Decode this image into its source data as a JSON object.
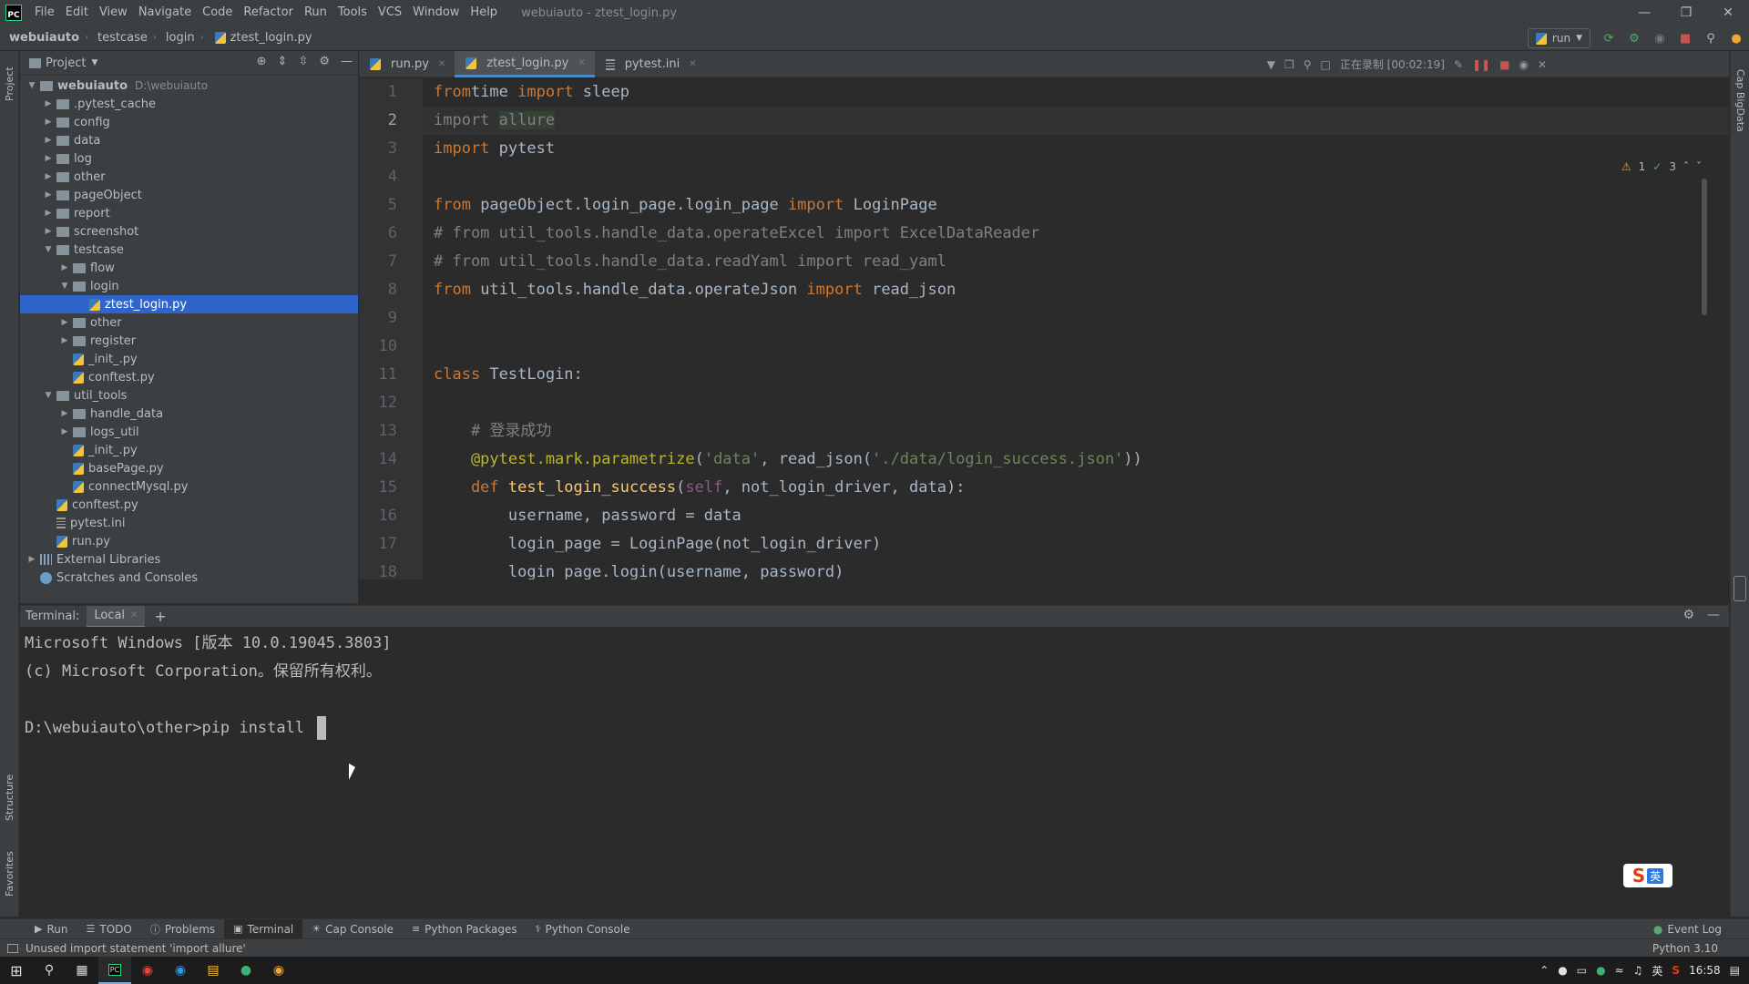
{
  "menubar": {
    "logo": "PC",
    "items": [
      "File",
      "Edit",
      "View",
      "Navigate",
      "Code",
      "Refactor",
      "Run",
      "Tools",
      "VCS",
      "Window",
      "Help"
    ],
    "title": "webuiauto - ztest_login.py"
  },
  "breadcrumb": [
    "webuiauto",
    "testcase",
    "login",
    "ztest_login.py"
  ],
  "run_config": {
    "label": "run"
  },
  "project_panel": {
    "title": "Project",
    "tree": [
      {
        "label": "webuiauto",
        "extra": "D:\\webuiauto",
        "depth": 0,
        "type": "folder",
        "open": true,
        "bold": true
      },
      {
        "label": ".pytest_cache",
        "depth": 1,
        "type": "folder",
        "open": false
      },
      {
        "label": "config",
        "depth": 1,
        "type": "folder",
        "open": false
      },
      {
        "label": "data",
        "depth": 1,
        "type": "folder",
        "open": false
      },
      {
        "label": "log",
        "depth": 1,
        "type": "folder",
        "open": false
      },
      {
        "label": "other",
        "depth": 1,
        "type": "folder",
        "open": false
      },
      {
        "label": "pageObject",
        "depth": 1,
        "type": "folder",
        "open": false
      },
      {
        "label": "report",
        "depth": 1,
        "type": "folder",
        "open": false
      },
      {
        "label": "screenshot",
        "depth": 1,
        "type": "folder",
        "open": false
      },
      {
        "label": "testcase",
        "depth": 1,
        "type": "folder",
        "open": true
      },
      {
        "label": "flow",
        "depth": 2,
        "type": "folder",
        "open": false
      },
      {
        "label": "login",
        "depth": 2,
        "type": "folder",
        "open": true
      },
      {
        "label": "ztest_login.py",
        "depth": 3,
        "type": "py",
        "selected": true
      },
      {
        "label": "other",
        "depth": 2,
        "type": "folder",
        "open": false
      },
      {
        "label": "register",
        "depth": 2,
        "type": "folder",
        "open": false
      },
      {
        "label": "_init_.py",
        "depth": 2,
        "type": "py"
      },
      {
        "label": "conftest.py",
        "depth": 2,
        "type": "py"
      },
      {
        "label": "util_tools",
        "depth": 1,
        "type": "folder",
        "open": true
      },
      {
        "label": "handle_data",
        "depth": 2,
        "type": "folder",
        "open": false
      },
      {
        "label": "logs_util",
        "depth": 2,
        "type": "folder",
        "open": false
      },
      {
        "label": "_init_.py",
        "depth": 2,
        "type": "py"
      },
      {
        "label": "basePage.py",
        "depth": 2,
        "type": "py"
      },
      {
        "label": "connectMysql.py",
        "depth": 2,
        "type": "py"
      },
      {
        "label": "conftest.py",
        "depth": 1,
        "type": "py"
      },
      {
        "label": "pytest.ini",
        "depth": 1,
        "type": "ini"
      },
      {
        "label": "run.py",
        "depth": 1,
        "type": "py"
      },
      {
        "label": "External Libraries",
        "depth": 0,
        "type": "lib",
        "open": false
      },
      {
        "label": "Scratches and Consoles",
        "depth": 0,
        "type": "scratch"
      }
    ]
  },
  "editor": {
    "tabs": [
      {
        "label": "run.py",
        "active": false
      },
      {
        "label": "ztest_login.py",
        "active": true
      },
      {
        "label": "pytest.ini",
        "active": false
      }
    ],
    "recording": "正在录制 [00:02:19]",
    "warnings": "1",
    "checks": "3",
    "current_line": 2,
    "lines": [
      [
        [
          "kw",
          "from"
        ],
        [
          "",
          "time "
        ],
        [
          "kw",
          "import"
        ],
        [
          "",
          " sleep"
        ]
      ],
      [
        [
          "unused",
          "import "
        ],
        [
          "unusedmod",
          "allure"
        ]
      ],
      [
        [
          "kw",
          "import"
        ],
        [
          "",
          " pytest"
        ]
      ],
      [],
      [
        [
          "kw",
          "from"
        ],
        [
          "",
          " pageObject.login_page.login_page "
        ],
        [
          "kw",
          "import"
        ],
        [
          "",
          " LoginPage"
        ]
      ],
      [
        [
          "cm",
          "# from util_tools.handle_data.operateExcel import ExcelDataReader"
        ]
      ],
      [
        [
          "cm",
          "# from util_tools.handle_data.readYaml import read_yaml"
        ]
      ],
      [
        [
          "kw",
          "from"
        ],
        [
          "",
          " util_tools.handle_data.operateJson "
        ],
        [
          "kw",
          "import"
        ],
        [
          "",
          " read_json"
        ]
      ],
      [],
      [],
      [
        [
          "kw",
          "class"
        ],
        [
          "",
          " TestLogin:"
        ]
      ],
      [],
      [
        [
          "cm",
          "    # 登录成功"
        ]
      ],
      [
        [
          "deco",
          "    @pytest.mark.parametrize"
        ],
        [
          "",
          "("
        ],
        [
          "str",
          "'data'"
        ],
        [
          "",
          ", read_json("
        ],
        [
          "str",
          "'./data/login_success.json'"
        ],
        [
          "",
          "))"
        ]
      ],
      [
        [
          "kw",
          "    def "
        ],
        [
          "fn",
          "test_login_success"
        ],
        [
          "",
          "("
        ],
        [
          "slf",
          "self"
        ],
        [
          "",
          ", not_login_driver, data):"
        ]
      ],
      [
        [
          "",
          "        username, password = data"
        ]
      ],
      [
        [
          "",
          "        login_page = LoginPage(not_login_driver)"
        ]
      ],
      [
        [
          "",
          "        login_page.login(username, password)"
        ]
      ]
    ]
  },
  "terminal": {
    "label": "Terminal:",
    "tab": "Local",
    "lines": [
      "Microsoft Windows [版本 10.0.19045.3803]",
      "(c) Microsoft Corporation。保留所有权利。",
      "",
      "D:\\webuiauto\\other>pip install "
    ]
  },
  "toolwindows": [
    {
      "label": "Run",
      "icon": "play-icon"
    },
    {
      "label": "TODO",
      "icon": "list-icon"
    },
    {
      "label": "Problems",
      "icon": "info-icon"
    },
    {
      "label": "Terminal",
      "icon": "terminal-icon",
      "active": true
    },
    {
      "label": "Cap Console",
      "icon": "bulb-icon"
    },
    {
      "label": "Python Packages",
      "icon": "layers-icon"
    },
    {
      "label": "Python Console",
      "icon": "python-icon"
    }
  ],
  "event_log": "Event Log",
  "status": {
    "message": "Unused import statement 'import allure'",
    "interpreter": "Python 3.10"
  },
  "left_strip": {
    "project": "Project",
    "structure": "Structure",
    "favorites": "Favorites"
  },
  "right_strip": {
    "label": "Cap BigData"
  },
  "ime": {
    "s": "S",
    "lang": "英"
  },
  "taskbar": {
    "clock": "16:58",
    "lang": "英"
  }
}
